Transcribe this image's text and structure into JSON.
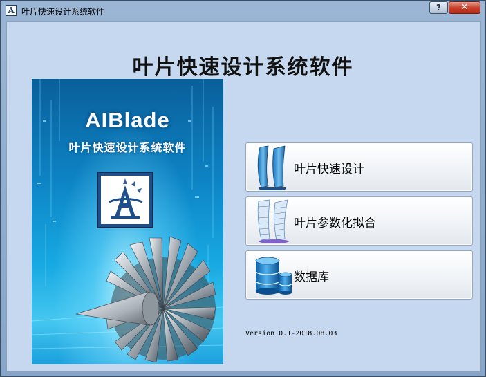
{
  "window": {
    "title": "叶片快速设计系统软件",
    "icon_letter": "A",
    "help_label": "?",
    "close_label": "✕"
  },
  "main": {
    "title": "叶片快速设计系统软件"
  },
  "banner": {
    "brand": "AIBlade",
    "subtitle": "叶片快速设计系统软件",
    "logo_letter": "A"
  },
  "buttons": [
    {
      "label": "叶片快速设计",
      "icon": "blade-design-icon"
    },
    {
      "label": "叶片参数化拟合",
      "icon": "blade-fitting-icon"
    },
    {
      "label": "数据库",
      "icon": "database-icon"
    }
  ],
  "version": "Version 0.1-2018.08.03",
  "colors": {
    "client_bg": "#c6d8ef",
    "banner_blue": "#17a9e2",
    "close_red": "#c7412b"
  }
}
